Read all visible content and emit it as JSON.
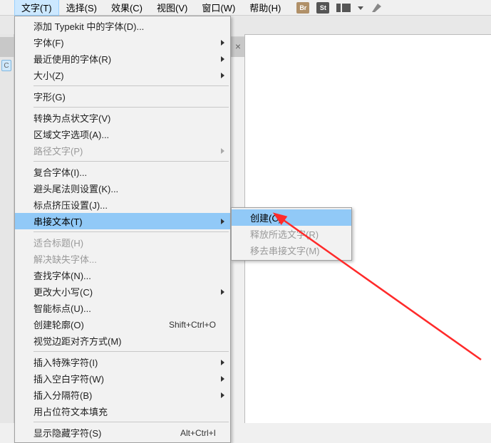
{
  "menubar": {
    "items": [
      {
        "label": "文字(T)",
        "active": true
      },
      {
        "label": "选择(S)"
      },
      {
        "label": "效果(C)"
      },
      {
        "label": "视图(V)"
      },
      {
        "label": "窗口(W)"
      },
      {
        "label": "帮助(H)"
      }
    ],
    "icon_br": "Br",
    "icon_st": "St"
  },
  "leftcol": {
    "tab_label": "C"
  },
  "tabbar": {
    "close_glyph": "×"
  },
  "menu": {
    "groups": [
      [
        {
          "label": "添加 Typekit 中的字体(D)...",
          "enabled": true
        },
        {
          "label": "字体(F)",
          "enabled": true,
          "submenu": true
        },
        {
          "label": "最近使用的字体(R)",
          "enabled": true,
          "submenu": true
        },
        {
          "label": "大小(Z)",
          "enabled": true,
          "submenu": true
        }
      ],
      [
        {
          "label": "字形(G)",
          "enabled": true
        }
      ],
      [
        {
          "label": "转换为点状文字(V)",
          "enabled": true
        },
        {
          "label": "区域文字选项(A)...",
          "enabled": true
        },
        {
          "label": "路径文字(P)",
          "enabled": false,
          "submenu": true
        }
      ],
      [
        {
          "label": "复合字体(I)...",
          "enabled": true
        },
        {
          "label": "避头尾法则设置(K)...",
          "enabled": true
        },
        {
          "label": "标点挤压设置(J)...",
          "enabled": true
        },
        {
          "label": "串接文本(T)",
          "enabled": true,
          "submenu": true,
          "highlight": true
        }
      ],
      [
        {
          "label": "适合标题(H)",
          "enabled": false
        },
        {
          "label": "解决缺失字体...",
          "enabled": false
        },
        {
          "label": "查找字体(N)...",
          "enabled": true
        },
        {
          "label": "更改大小写(C)",
          "enabled": true,
          "submenu": true
        },
        {
          "label": "智能标点(U)...",
          "enabled": true
        },
        {
          "label": "创建轮廓(O)",
          "enabled": true,
          "shortcut": "Shift+Ctrl+O"
        },
        {
          "label": "视觉边距对齐方式(M)",
          "enabled": true
        }
      ],
      [
        {
          "label": "插入特殊字符(I)",
          "enabled": true,
          "submenu": true
        },
        {
          "label": "插入空白字符(W)",
          "enabled": true,
          "submenu": true
        },
        {
          "label": "插入分隔符(B)",
          "enabled": true,
          "submenu": true
        },
        {
          "label": "用占位符文本填充",
          "enabled": true
        }
      ],
      [
        {
          "label": "显示隐藏字符(S)",
          "enabled": true,
          "shortcut": "Alt+Ctrl+I"
        }
      ]
    ]
  },
  "submenu": {
    "items": [
      {
        "label": "创建(C)",
        "enabled": true,
        "highlight": true
      },
      {
        "label": "释放所选文字(R)",
        "enabled": false
      },
      {
        "label": "移去串接文字(M)",
        "enabled": false
      }
    ]
  }
}
